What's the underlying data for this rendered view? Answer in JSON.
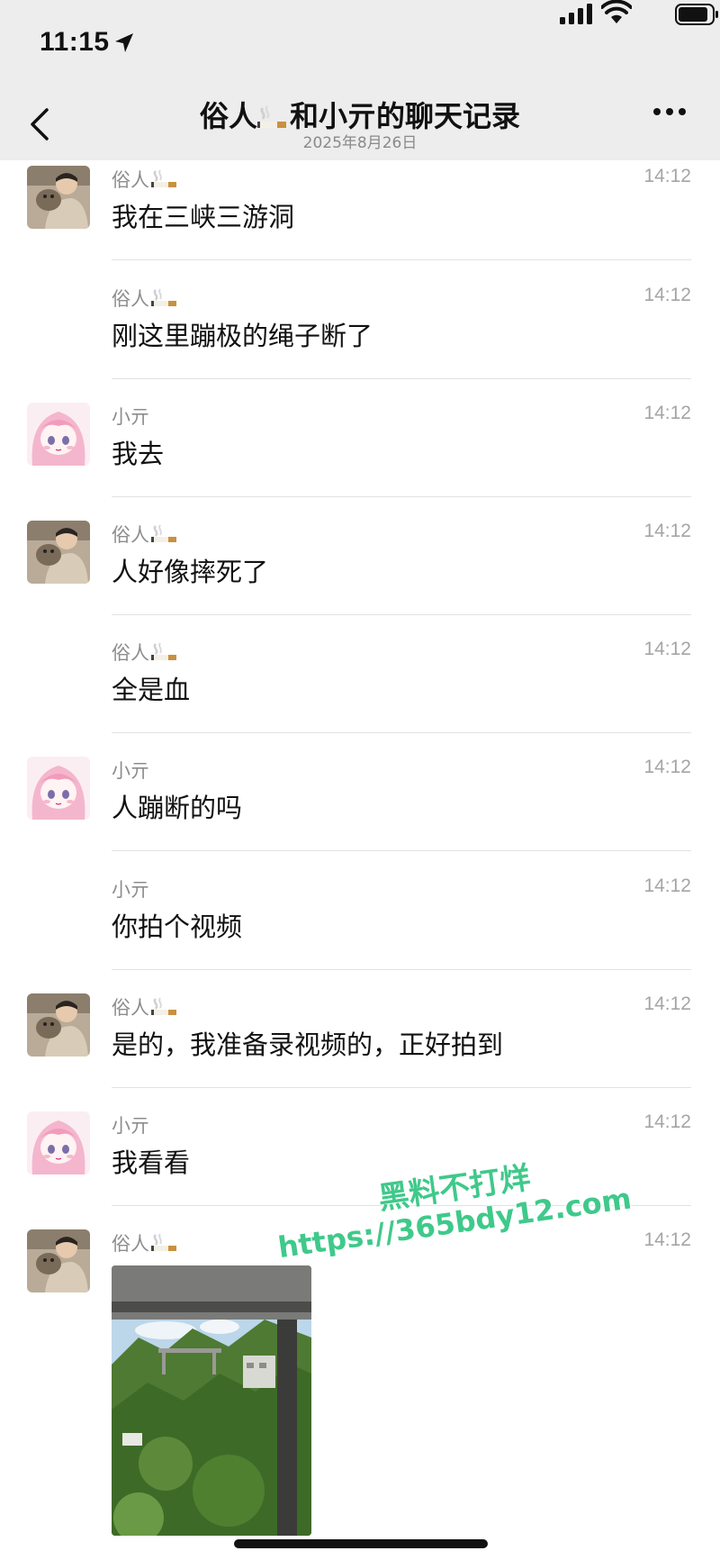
{
  "status_bar": {
    "time": "11:15"
  },
  "header": {
    "title_a": "俗人",
    "title_b": "和小亓的聊天记录",
    "subtitle": "2025年8月26日"
  },
  "messages": [
    {
      "sender": "俗人",
      "time": "14:12",
      "text": "我在三峡三游洞",
      "avatar": "man-with-cat"
    },
    {
      "sender": "俗人",
      "time": "14:12",
      "text": "刚这里蹦极的绳子断了",
      "avatar": ""
    },
    {
      "sender": "小亓",
      "time": "14:12",
      "text": "我去",
      "avatar": "anime-girl"
    },
    {
      "sender": "俗人",
      "time": "14:12",
      "text": "人好像摔死了",
      "avatar": "man-with-cat"
    },
    {
      "sender": "俗人",
      "time": "14:12",
      "text": "全是血",
      "avatar": ""
    },
    {
      "sender": "小亓",
      "time": "14:12",
      "text": "人蹦断的吗",
      "avatar": "anime-girl"
    },
    {
      "sender": "小亓",
      "time": "14:12",
      "text": "你拍个视频",
      "avatar": ""
    },
    {
      "sender": "俗人",
      "time": "14:12",
      "text": "是的，我准备录视频的，正好拍到",
      "avatar": "man-with-cat"
    },
    {
      "sender": "小亓",
      "time": "14:12",
      "text": "我看看",
      "avatar": "anime-girl"
    },
    {
      "sender": "俗人",
      "time": "14:12",
      "text": "",
      "avatar": "man-with-cat"
    }
  ],
  "watermark": {
    "line1": "黑料不打烊",
    "line2": "https://365bdy12.com"
  },
  "colors": {
    "header_bg": "#ededed",
    "watermark": "#3fc98a",
    "meta_text": "#8d8d8d"
  }
}
